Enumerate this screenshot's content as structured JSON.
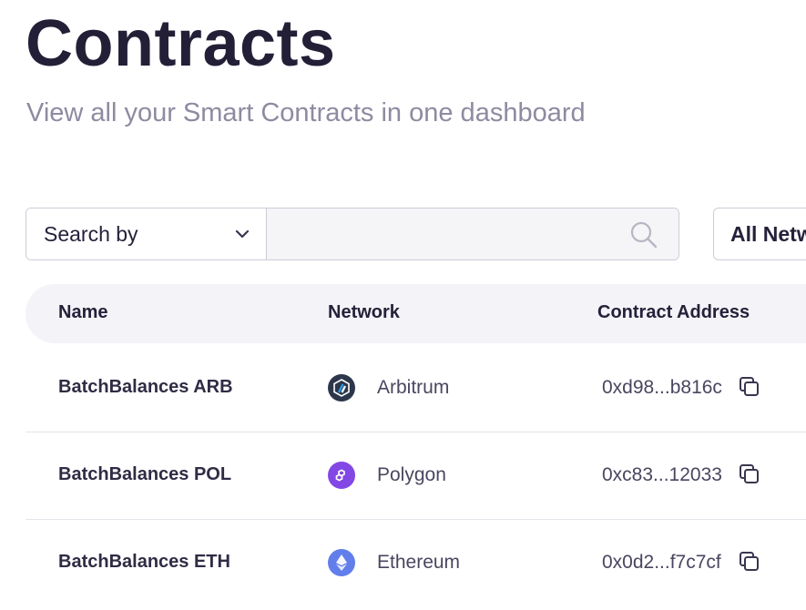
{
  "header": {
    "title": "Contracts",
    "subtitle": "View all your Smart Contracts in one dashboard"
  },
  "search": {
    "select_label": "Search by",
    "input_value": "",
    "input_placeholder": ""
  },
  "filter": {
    "network_label": "All Netw"
  },
  "table": {
    "columns": [
      "Name",
      "Network",
      "Contract Address"
    ],
    "rows": [
      {
        "name": "BatchBalances ARB",
        "network": "Arbitrum",
        "network_icon": "arbitrum-icon",
        "address": "0xd98...b816c"
      },
      {
        "name": "BatchBalances POL",
        "network": "Polygon",
        "network_icon": "polygon-icon",
        "address": "0xc83...12033"
      },
      {
        "name": "BatchBalances ETH",
        "network": "Ethereum",
        "network_icon": "ethereum-icon",
        "address": "0x0d2...f7c7cf"
      }
    ]
  },
  "colors": {
    "arbitrum": "#2d374b",
    "polygon": "#8247e5",
    "ethereum": "#627eea"
  }
}
